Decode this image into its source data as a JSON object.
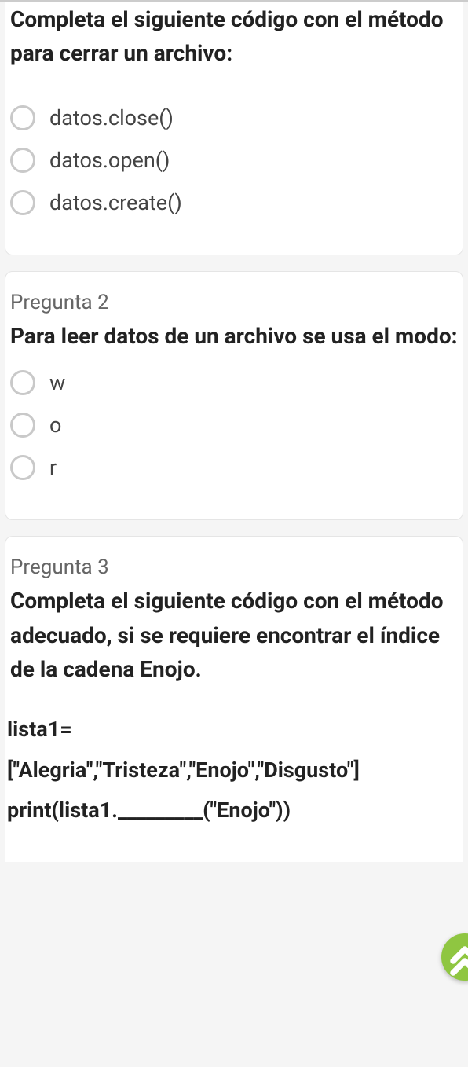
{
  "questions": [
    {
      "label": "",
      "text": "Completa el siguiente código con el método para cerrar un archivo:",
      "code": "",
      "options": [
        "datos.close()",
        "datos.open()",
        "datos.create()"
      ]
    },
    {
      "label": "Pregunta 2",
      "text": "Para leer datos de un archivo se usa el modo:",
      "code": "",
      "options": [
        "w",
        "o",
        "r"
      ]
    },
    {
      "label": "Pregunta 3",
      "text": "Completa el siguiente código con el método adecuado, si se requiere encontrar el índice de la cadena Enojo.",
      "code": "lista1=[\"Alegria\",\"Tristeza\",\"Enojo\",\"Disgusto\"]\nprint(lista1._________(\"Enojo\"))",
      "options": []
    }
  ],
  "icons": {
    "scroll_top": "scroll-top-icon"
  }
}
